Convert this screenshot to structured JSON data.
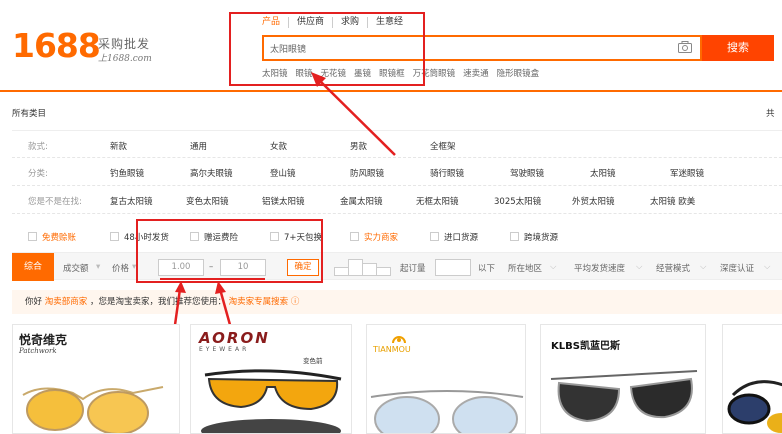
{
  "header": {
    "logo_number": "1688",
    "logo_cn": "采购批发",
    "logo_url": "上1688.com",
    "search_tabs": [
      "产品",
      "供应商",
      "求购",
      "生意经"
    ],
    "search_value": "太阳眼镜",
    "search_button": "搜索",
    "hot_words": [
      "太阳镜",
      "眼镜",
      "无花镜",
      "墨镜",
      "眼镜框",
      "万花筒眼镜",
      "速卖通",
      "隐形眼镜盒"
    ]
  },
  "categories": {
    "all_label": "所有类目",
    "total_prefix": "共",
    "rows": [
      {
        "label": "款式:",
        "values": [
          "新款",
          "通用",
          "女款",
          "男款",
          "全框架"
        ]
      },
      {
        "label": "分类:",
        "values": [
          "钓鱼眼镜",
          "高尔夫眼镜",
          "登山镜",
          "防风眼镜",
          "骑行眼镜",
          "驾驶眼镜",
          "太阳镜",
          "军迷眼镜"
        ]
      },
      {
        "label": "您是不是在找:",
        "values": [
          "复古太阳镜",
          "变色太阳镜",
          "铝镁太阳镜",
          "金属太阳镜",
          "无框太阳镜",
          "3025太阳镜",
          "外贸太阳镜",
          "太阳镜 欧美"
        ]
      }
    ]
  },
  "filters": {
    "checkboxes": [
      {
        "label": "免费赊账",
        "highlight": true
      },
      {
        "label": "48小时发货",
        "highlight": false
      },
      {
        "label": "赠运费险",
        "highlight": false
      },
      {
        "label": "7+天包换",
        "highlight": false
      },
      {
        "label": "实力商家",
        "highlight": true
      },
      {
        "label": "进口货源",
        "highlight": false
      },
      {
        "label": "跨境货源",
        "highlight": false
      }
    ],
    "sort_default": "综合",
    "sort_volume": "成交额",
    "sort_price": "价格",
    "price_min": "1.00",
    "price_sep": "–",
    "price_max": "10",
    "price_ok": "确定",
    "moq_label": "起订量",
    "moq_suffix": "以下",
    "selects": [
      "所在地区",
      "平均发货速度",
      "经营模式",
      "深度认证"
    ]
  },
  "tip": {
    "prefix": "你好",
    "link1": "淘卖部商家",
    "middle": "，您是淘宝卖家，我们推荐您使用：",
    "link2": "淘卖家专属搜索"
  },
  "products": [
    {
      "brand": "悦奇维克",
      "sub": "Patchwork"
    },
    {
      "brand": "AORON",
      "sub": "EYEWEAR",
      "tag": "变色前"
    },
    {
      "brand": "TIANMOU"
    },
    {
      "brand": "KLBS凯蓝巴斯"
    },
    {
      "brand": ""
    }
  ],
  "colors": {
    "accent": "#ff6a00",
    "search_button": "#ff4400",
    "annotation": "#e32020"
  }
}
